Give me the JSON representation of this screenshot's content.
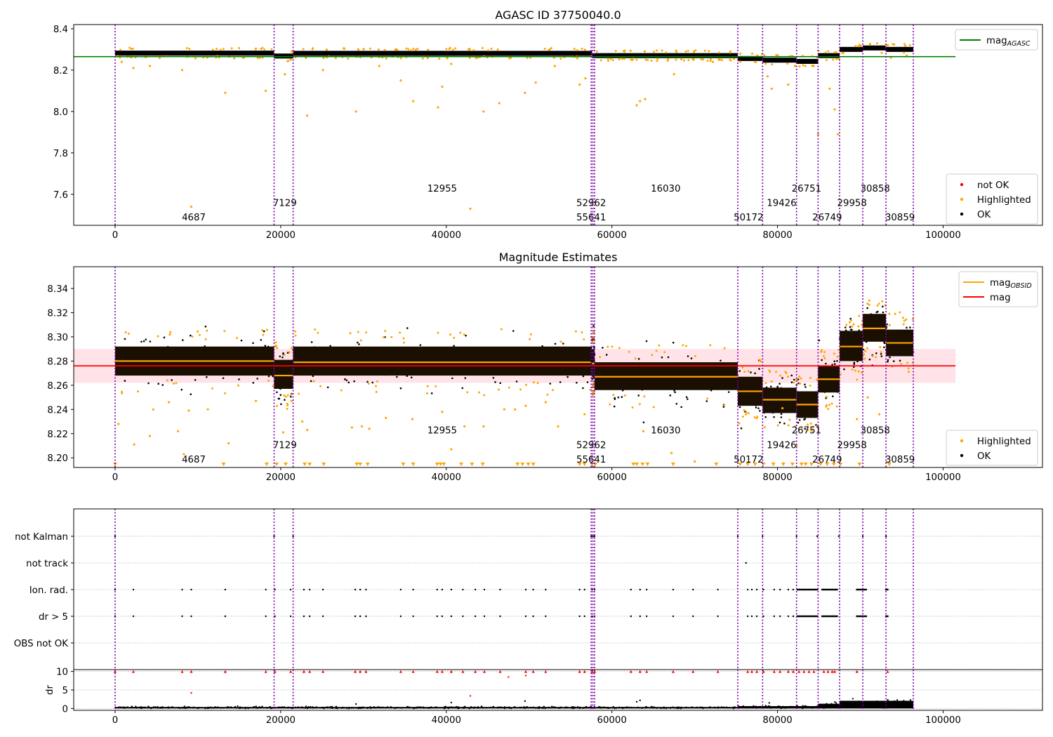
{
  "chart_data": [
    {
      "type": "scatter",
      "title": "AGASC ID 37750040.0",
      "xlim": [
        -5000,
        112000
      ],
      "ylim": [
        7.45,
        8.42
      ],
      "x_ticks": [
        0,
        20000,
        40000,
        60000,
        80000,
        100000
      ],
      "y_ticks": [
        7.6,
        7.8,
        8.0,
        8.2,
        8.4
      ],
      "reference_line": {
        "label": "mag_AGASC",
        "value": 8.265,
        "x_range": [
          -5000,
          101500
        ],
        "color": "#008000"
      },
      "legend_top": [
        {
          "label": "mag",
          "sub": "AGASC",
          "color": "#008000",
          "marker": "line"
        }
      ],
      "legend_bottom": [
        {
          "label": "not OK",
          "color": "#ff0000",
          "marker": "dot"
        },
        {
          "label": "Highlighted",
          "color": "#ffa500",
          "marker": "dot"
        },
        {
          "label": "OK",
          "color": "#000000",
          "marker": "dot"
        }
      ],
      "highlighted_points": [
        [
          800,
          8.24
        ],
        [
          2200,
          8.21
        ],
        [
          4200,
          8.22
        ],
        [
          8100,
          8.2
        ],
        [
          9200,
          7.54
        ],
        [
          13300,
          8.09
        ],
        [
          18200,
          8.1
        ],
        [
          20500,
          8.18
        ],
        [
          21200,
          8.25
        ],
        [
          23200,
          7.98
        ],
        [
          25100,
          8.2
        ],
        [
          29100,
          8.0
        ],
        [
          31900,
          8.22
        ],
        [
          34500,
          8.15
        ],
        [
          36000,
          8.05
        ],
        [
          39000,
          8.02
        ],
        [
          39500,
          8.12
        ],
        [
          40600,
          8.23
        ],
        [
          42900,
          7.53
        ],
        [
          44500,
          8.0
        ],
        [
          46400,
          8.04
        ],
        [
          49500,
          8.09
        ],
        [
          50800,
          8.14
        ],
        [
          53100,
          8.22
        ],
        [
          56100,
          8.13
        ],
        [
          56800,
          8.16
        ],
        [
          63000,
          8.03
        ],
        [
          63400,
          8.05
        ],
        [
          64000,
          8.06
        ],
        [
          67500,
          8.18
        ],
        [
          72200,
          8.24
        ],
        [
          78800,
          8.17
        ],
        [
          79300,
          8.11
        ],
        [
          81300,
          8.13
        ],
        [
          82100,
          8.22
        ],
        [
          84900,
          7.89
        ],
        [
          86300,
          8.11
        ],
        [
          86900,
          8.01
        ],
        [
          87300,
          7.89
        ],
        [
          93700,
          8.26
        ],
        [
          95600,
          8.27
        ]
      ]
    },
    {
      "type": "scatter",
      "title": "Magnitude Estimates",
      "xlim": [
        -5000,
        112000
      ],
      "ylim": [
        8.192,
        8.358
      ],
      "x_ticks": [
        0,
        20000,
        40000,
        60000,
        80000,
        100000
      ],
      "y_ticks": [
        8.2,
        8.22,
        8.24,
        8.26,
        8.28,
        8.3,
        8.32,
        8.34
      ],
      "mag": {
        "label": "mag",
        "value": 8.276,
        "band": [
          8.262,
          8.29
        ],
        "x_range": [
          -5000,
          101500
        ],
        "color": "#ff0000"
      },
      "legend_top": [
        {
          "label": "mag",
          "sub": "OBSID",
          "color": "#ffa500",
          "marker": "line"
        },
        {
          "label": "mag",
          "sub": "",
          "color": "#ff0000",
          "marker": "line"
        }
      ],
      "legend_bottom": [
        {
          "label": "Highlighted",
          "color": "#ffa500",
          "marker": "dot"
        },
        {
          "label": "OK",
          "color": "#000000",
          "marker": "dot"
        }
      ],
      "segments": [
        {
          "x0": 0,
          "x1": 19200,
          "mean": 8.28,
          "lo": 8.268,
          "hi": 8.292
        },
        {
          "x0": 19200,
          "x1": 21500,
          "mean": 8.268,
          "lo": 8.257,
          "hi": 8.281
        },
        {
          "x0": 21500,
          "x1": 57600,
          "mean": 8.279,
          "lo": 8.268,
          "hi": 8.292
        },
        {
          "x0": 57600,
          "x1": 57900,
          "mean": 8.278,
          "lo": 8.267,
          "hi": 8.29
        },
        {
          "x0": 57900,
          "x1": 75200,
          "mean": 8.267,
          "lo": 8.256,
          "hi": 8.279
        },
        {
          "x0": 75200,
          "x1": 78200,
          "mean": 8.255,
          "lo": 8.243,
          "hi": 8.267
        },
        {
          "x0": 78200,
          "x1": 82300,
          "mean": 8.248,
          "lo": 8.237,
          "hi": 8.258
        },
        {
          "x0": 82300,
          "x1": 84900,
          "mean": 8.244,
          "lo": 8.233,
          "hi": 8.255
        },
        {
          "x0": 84900,
          "x1": 87500,
          "mean": 8.265,
          "lo": 8.254,
          "hi": 8.276
        },
        {
          "x0": 87500,
          "x1": 90300,
          "mean": 8.292,
          "lo": 8.28,
          "hi": 8.305
        },
        {
          "x0": 90300,
          "x1": 93100,
          "mean": 8.307,
          "lo": 8.296,
          "hi": 8.319
        },
        {
          "x0": 93100,
          "x1": 96400,
          "mean": 8.295,
          "lo": 8.284,
          "hi": 8.306
        }
      ],
      "highlighted_points": [
        [
          400,
          8.228
        ],
        [
          2300,
          8.211
        ],
        [
          4200,
          8.218
        ],
        [
          4600,
          8.24
        ],
        [
          6500,
          8.246
        ],
        [
          7600,
          8.222
        ],
        [
          8300,
          8.203
        ],
        [
          8900,
          8.239
        ],
        [
          11200,
          8.24
        ],
        [
          13700,
          8.212
        ],
        [
          17000,
          8.247
        ],
        [
          20300,
          8.221
        ],
        [
          21300,
          8.247
        ],
        [
          22600,
          8.23
        ],
        [
          23200,
          8.223
        ],
        [
          28600,
          8.225
        ],
        [
          29800,
          8.226
        ],
        [
          30700,
          8.224
        ],
        [
          32700,
          8.233
        ],
        [
          35900,
          8.232
        ],
        [
          39500,
          8.238
        ],
        [
          40600,
          8.207
        ],
        [
          42200,
          8.226
        ],
        [
          44500,
          8.226
        ],
        [
          47000,
          8.24
        ],
        [
          48300,
          8.24
        ],
        [
          49600,
          8.243
        ],
        [
          52000,
          8.246
        ],
        [
          53500,
          8.226
        ],
        [
          56700,
          8.236
        ],
        [
          63800,
          8.222
        ],
        [
          67200,
          8.204
        ],
        [
          70000,
          8.197
        ],
        [
          80600,
          8.241
        ],
        [
          82300,
          8.21
        ],
        [
          89600,
          8.232
        ],
        [
          90900,
          8.25
        ],
        [
          92300,
          8.236
        ]
      ],
      "triangle_markers_x": [
        0,
        13100,
        18300,
        19500,
        20600,
        22900,
        23500,
        25200,
        29200,
        29600,
        30500,
        34800,
        36000,
        38900,
        39300,
        39700,
        41800,
        43100,
        44400,
        48600,
        49200,
        49900,
        50500,
        56100,
        56700,
        57600,
        58000,
        62600,
        63000,
        63700,
        64300,
        67400,
        72600,
        75500,
        76400,
        77300,
        78300,
        79500,
        80700,
        81800,
        82900,
        83400,
        84100,
        85200,
        86000,
        86800,
        87600,
        89900,
        93500
      ],
      "obsid_labels": [
        {
          "text": "4687",
          "x": 9500,
          "y": 8.199
        },
        {
          "text": "7129",
          "x": 20500,
          "y": 8.211
        },
        {
          "text": "12955",
          "x": 39500,
          "y": 8.223
        },
        {
          "text": "52962",
          "x": 57500,
          "y": 8.211
        },
        {
          "text": "55641",
          "x": 57500,
          "y": 8.199
        },
        {
          "text": "16030",
          "x": 66500,
          "y": 8.223
        },
        {
          "text": "50172",
          "x": 76500,
          "y": 8.199
        },
        {
          "text": "19426",
          "x": 80500,
          "y": 8.211
        },
        {
          "text": "26751",
          "x": 83500,
          "y": 8.223
        },
        {
          "text": "26749",
          "x": 86000,
          "y": 8.199
        },
        {
          "text": "29958",
          "x": 89000,
          "y": 8.211
        },
        {
          "text": "30858",
          "x": 91800,
          "y": 8.223
        },
        {
          "text": "30859",
          "x": 94800,
          "y": 8.199
        }
      ]
    },
    {
      "type": "scatter",
      "title": "",
      "xlim": [
        -5000,
        112000
      ],
      "categories": [
        "not Kalman",
        "not track",
        "Ion. rad.",
        "dr > 5",
        "OBS not OK"
      ],
      "flag_points": {
        "not Kalman": [
          0,
          19200,
          21500,
          57500,
          57700,
          57900,
          75200,
          78200,
          82300,
          84800,
          87400,
          90300,
          93100
        ],
        "not track": [
          76200
        ],
        "Ion. rad.": [
          0,
          2200,
          8100,
          9200,
          13300,
          18200,
          19300,
          21200,
          22800,
          23500,
          25100,
          29000,
          29600,
          30300,
          34500,
          36000,
          38900,
          39500,
          40600,
          42000,
          43500,
          44600,
          46500,
          49600,
          50500,
          52000,
          56100,
          56700,
          57600,
          57900,
          62300,
          63400,
          64200,
          67400,
          69800,
          72800,
          76400,
          76900,
          77500,
          78300,
          79600,
          80300,
          81300,
          81900,
          82600,
          83200,
          83800,
          84400,
          85600,
          86100,
          86600,
          86900,
          89600,
          93300
        ],
        "dr > 5": [
          0,
          2200,
          8100,
          9200,
          13300,
          18200,
          19300,
          21200,
          22800,
          23500,
          25100,
          29000,
          29600,
          30300,
          34500,
          36000,
          38900,
          39500,
          40600,
          42000,
          43500,
          44600,
          46500,
          49600,
          50500,
          52000,
          56100,
          56700,
          57600,
          57900,
          62300,
          63400,
          64200,
          67400,
          69800,
          72800,
          76400,
          76900,
          77500,
          78300,
          79600,
          80300,
          81300,
          81900,
          82600,
          83200,
          83800,
          84400,
          85600,
          86100,
          86600,
          86900,
          89600,
          93300
        ],
        "OBS not OK": []
      }
    },
    {
      "type": "scatter",
      "title": "",
      "ylabel": "dr",
      "xlim": [
        -5000,
        112000
      ],
      "ylim": [
        -0.5,
        10.5
      ],
      "x_ticks": [
        0,
        20000,
        40000,
        60000,
        80000,
        100000
      ],
      "y_ticks": [
        0,
        5,
        10
      ],
      "red_points_at_10_x": [
        0,
        2200,
        8100,
        9200,
        13300,
        18200,
        19300,
        21200,
        22800,
        23500,
        25100,
        29000,
        29600,
        30300,
        34500,
        36000,
        38900,
        39500,
        40600,
        42000,
        43500,
        44600,
        46500,
        49600,
        50500,
        52000,
        56100,
        56700,
        57600,
        57900,
        62300,
        63400,
        64200,
        67400,
        69800,
        72800,
        76400,
        76900,
        77500,
        78300,
        79600,
        80300,
        81300,
        81900,
        82600,
        83200,
        83800,
        84400,
        85600,
        86100,
        86600,
        86900,
        89600,
        93300
      ],
      "red_points_other": [
        [
          9200,
          4.2
        ],
        [
          47500,
          8.5
        ],
        [
          42900,
          3.4
        ],
        [
          49600,
          8.9
        ]
      ],
      "obs_windows": [
        {
          "x0": 0,
          "x1": 75200,
          "level": 0.25
        },
        {
          "x0": 75200,
          "x1": 84900,
          "level": 0.4
        },
        {
          "x0": 84900,
          "x1": 87500,
          "level": 0.8
        },
        {
          "x0": 87500,
          "x1": 96400,
          "level": 1.3
        }
      ]
    }
  ],
  "obsid_boundaries_x": [
    0,
    19200,
    21500,
    57500,
    57700,
    57900,
    75200,
    78200,
    82300,
    84900,
    87500,
    90300,
    93100,
    96400
  ],
  "top_obsid_labels": [
    {
      "text": "4687",
      "x": 9500,
      "y": 7.49
    },
    {
      "text": "7129",
      "x": 20500,
      "y": 7.56
    },
    {
      "text": "12955",
      "x": 39500,
      "y": 7.63
    },
    {
      "text": "52962",
      "x": 57500,
      "y": 7.56
    },
    {
      "text": "55641",
      "x": 57500,
      "y": 7.49
    },
    {
      "text": "16030",
      "x": 66500,
      "y": 7.63
    },
    {
      "text": "50172",
      "x": 76500,
      "y": 7.49
    },
    {
      "text": "19426",
      "x": 80500,
      "y": 7.56
    },
    {
      "text": "26751",
      "x": 83500,
      "y": 7.63
    },
    {
      "text": "26749",
      "x": 86000,
      "y": 7.49
    },
    {
      "text": "29958",
      "x": 89000,
      "y": 7.56
    },
    {
      "text": "30858",
      "x": 91800,
      "y": 7.63
    },
    {
      "text": "30859",
      "x": 94800,
      "y": 7.49
    }
  ],
  "colors": {
    "ok": "#000000",
    "highlighted": "#ffa500",
    "not_ok": "#ff0000",
    "boundary": "#7b00a8",
    "agasc": "#008000",
    "mag": "#ff0000",
    "obsid_mag": "#ffa500",
    "band": "#ffc0cb"
  }
}
